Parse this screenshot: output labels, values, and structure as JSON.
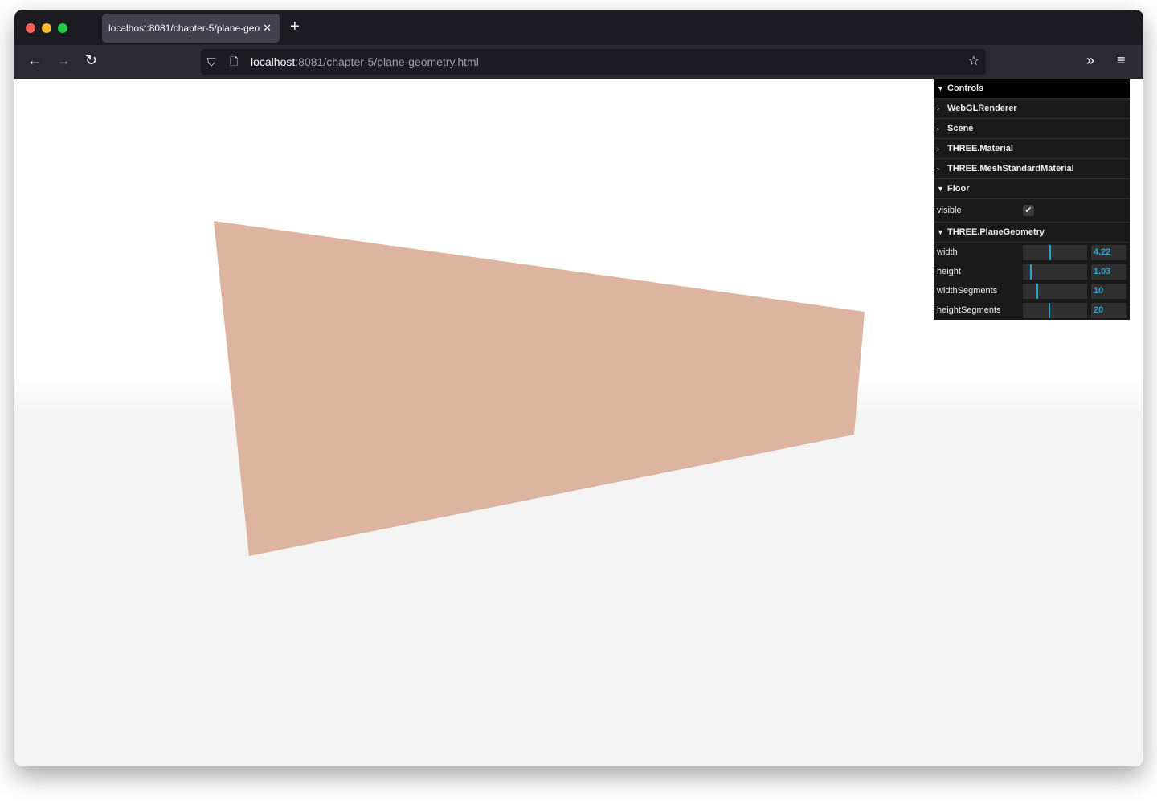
{
  "browser": {
    "tab_title": "localhost:8081/chapter-5/plane-geo",
    "tab_close": "✕",
    "new_tab": "+",
    "url_host": "localhost",
    "url_rest": ":8081/chapter-5/plane-geometry.html"
  },
  "scene": {
    "plane_color": "#dcb4a0",
    "floor_color": "#f4f4f4"
  },
  "gui": {
    "header": "Controls",
    "folders": [
      "WebGLRenderer",
      "Scene",
      "THREE.Material",
      "THREE.MeshStandardMaterial"
    ],
    "floor": {
      "label": "Floor",
      "visible_label": "visible",
      "visible": true,
      "check": "✔"
    },
    "geometry": {
      "label": "THREE.PlaneGeometry",
      "props": [
        {
          "label": "width",
          "value": "4.22",
          "slider_level": 0.41
        },
        {
          "label": "height",
          "value": "1.03",
          "slider_level": 0.11
        },
        {
          "label": "widthSegments",
          "value": "10",
          "slider_level": 0.21
        },
        {
          "label": "heightSegments",
          "value": "20",
          "slider_level": 0.4
        }
      ]
    }
  }
}
